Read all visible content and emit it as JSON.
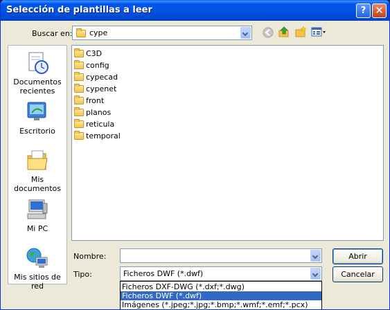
{
  "window": {
    "title": "Selección de plantillas a leer"
  },
  "titlebar": {
    "help_glyph": "?",
    "close_glyph": "✕"
  },
  "lookin": {
    "label": "Buscar en:",
    "value": "cype"
  },
  "places": [
    {
      "label": "Documentos recientes",
      "icon": "recent-documents-icon"
    },
    {
      "label": "Escritorio",
      "icon": "desktop-icon"
    },
    {
      "label": "Mis documentos",
      "icon": "my-documents-icon"
    },
    {
      "label": "Mi PC",
      "icon": "my-computer-icon"
    },
    {
      "label": "Mis sitios de red",
      "icon": "network-places-icon"
    }
  ],
  "files": [
    "C3D",
    "config",
    "cypecad",
    "cypenet",
    "front",
    "planos",
    "reticula",
    "temporal"
  ],
  "filename": {
    "label": "Nombre:",
    "value": ""
  },
  "filetype": {
    "label": "Tipo:",
    "value": "Ficheros DWF (*.dwf)",
    "options": [
      "Ficheros DXF-DWG (*.dxf;*.dwg)",
      "Ficheros DWF (*.dwf)",
      "Imágenes (*.jpeg;*.jpg;*.bmp;*.wmf;*.emf;*.pcx)"
    ],
    "selected_index": 1
  },
  "buttons": {
    "open": "Abrir",
    "cancel": "Cancelar"
  },
  "colors": {
    "title_bar": "#0054e3",
    "selection": "#316ac5",
    "dialog_bg": "#ece9d8"
  }
}
